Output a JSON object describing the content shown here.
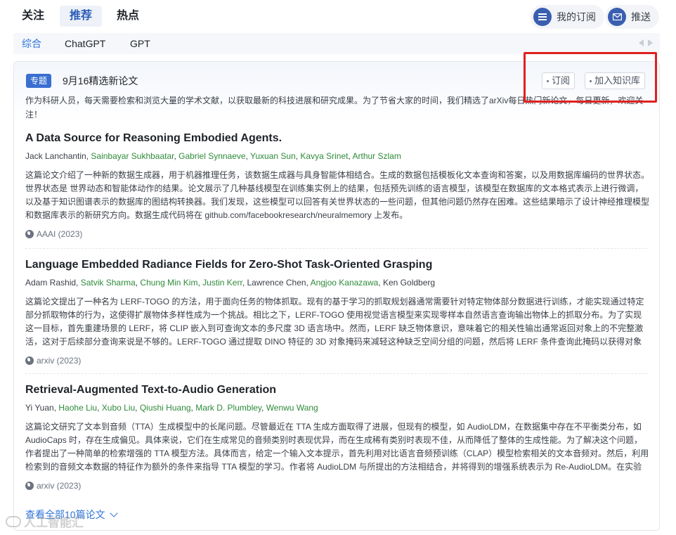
{
  "topnav": {
    "tabs": [
      "关注",
      "推荐",
      "热点"
    ],
    "active_tab": "推荐",
    "subscriptions_label": "我的订阅",
    "push_label": "推送"
  },
  "subtabs": {
    "items": [
      "综合",
      "ChatGPT",
      "GPT"
    ],
    "active": "综合"
  },
  "card": {
    "badge": "专题",
    "title": "9月16精选新论文",
    "subscribe_label": "订阅",
    "add_library_label": "加入知识库",
    "intro": "作为科研人员，每天需要检索和浏览大量的学术文献，以获取最新的科技进展和研究成果。为了节省大家的时间，我们精选了arXiv每日热门新论文，每日更新，欢迎关注！"
  },
  "papers": [
    {
      "title": "A Data Source for Reasoning Embodied Agents.",
      "authors": [
        {
          "name": "Jack Lanchantin",
          "linked": false
        },
        {
          "name": "Sainbayar Sukhbaatar",
          "linked": true
        },
        {
          "name": "Gabriel Synnaeve",
          "linked": true
        },
        {
          "name": "Yuxuan Sun",
          "linked": true
        },
        {
          "name": "Kavya Srinet",
          "linked": true
        },
        {
          "name": "Arthur Szlam",
          "linked": true
        }
      ],
      "summary": "这篇论文介绍了一种新的数据生成器，用于机器推理任务，该数据生成器与具身智能体相结合。生成的数据包括模板化文本查询和答案，以及用数据库编码的世界状态。世界状态是 世界动态和智能体动作的结果。论文展示了几种基线模型在训练集实例上的结果，包括预先训练的语言模型，该模型在数据库的文本格式表示上进行微调，以及基于知识图谱表示的数据库的图结构转换器。我们发现，这些模型可以回答有关世界状态的一些问题，但其他问题仍然存在困难。这些结果暗示了设计神经推理模型和数据库表示的新研究方向。数据生成代码将在 github.com/facebookresearch/neuralmemory 上发布。",
      "venue": "AAAI (2023)"
    },
    {
      "title": "Language Embedded Radiance Fields for Zero-Shot Task-Oriented Grasping",
      "authors": [
        {
          "name": "Adam Rashid",
          "linked": false
        },
        {
          "name": "Satvik Sharma",
          "linked": true
        },
        {
          "name": "Chung Min Kim",
          "linked": true
        },
        {
          "name": "Justin Kerr",
          "linked": true
        },
        {
          "name": "Lawrence Chen",
          "linked": false
        },
        {
          "name": "Angjoo Kanazawa",
          "linked": true
        },
        {
          "name": "Ken Goldberg",
          "linked": false
        }
      ],
      "summary": "这篇论文提出了一种名为 LERF-TOGO 的方法，用于面向任务的物体抓取。现有的基于学习的抓取规划器通常需要针对特定物体部分数据进行训练，才能实现通过特定部分抓取物体的行为，这使得扩展物体多样性成为一个挑战。相比之下，LERF-TOGO 使用视觉语言模型来实现零样本自然语言查询输出物体上的抓取分布。为了实现这一目标，首先重建场景的 LERF，将 CLIP 嵌入到可查询文本的多尺度 3D 语言场中。然而，LERF 缺乏物体意识，意味着它的相关性输出通常返回对象上的不完整激活，这对于后续部分查询来说是不够的。LERF-TOGO 通过提取 DINO 特征的 3D 对象掩码来减轻这种缺乏空间分组的问题，然后将 LERF 条件查询此掩码以获得对象上的语义分布，用于对抓取进行排序。",
      "venue": "arxiv (2023)"
    },
    {
      "title": "Retrieval-Augmented Text-to-Audio Generation",
      "authors": [
        {
          "name": "Yi Yuan",
          "linked": false
        },
        {
          "name": "Haohe Liu",
          "linked": true
        },
        {
          "name": "Xubo Liu",
          "linked": true
        },
        {
          "name": "Qiushi Huang",
          "linked": true
        },
        {
          "name": "Mark D. Plumbley",
          "linked": true
        },
        {
          "name": "Wenwu Wang",
          "linked": true
        }
      ],
      "summary": "这篇论文研究了文本到音频（TTA）生成模型中的长尾问题。尽管最近在 TTA 生成方面取得了进展，但现有的模型，如 AudioLDM，在数据集中存在不平衡类分布，如 AudioCaps 时，存在生成偏见。具体来说，它们在生成常见的音频类别时表现优异，而在生成稀有类别时表现不佳，从而降低了整体的生成性能。为了解决这个问题，作者提出了一种简单的检索增强的 TTA 模型方法。具体而言，给定一个输入文本提示，首先利用对比语言音频预训练（CLAP）模型检索相关的文本音频对。然后，利用检索到的音频文本数据的特征作为额外的条件来指导 TTA 模型的学习。作者将 AudioLDM 与所提出的方法相结合，并将得到的增强系统表示为 Re-AudioLDM。在实验中表明，该方法显著提升了生成质量。",
      "venue": "arxiv (2023)"
    }
  ],
  "view_all_label": "查看全部10篇论文",
  "watermark": "人工智能汇",
  "colors": {
    "accent": "#2f73d9",
    "author_link": "#2e8b3a",
    "highlight": "#e02020",
    "badge": "#3a6fd1"
  }
}
